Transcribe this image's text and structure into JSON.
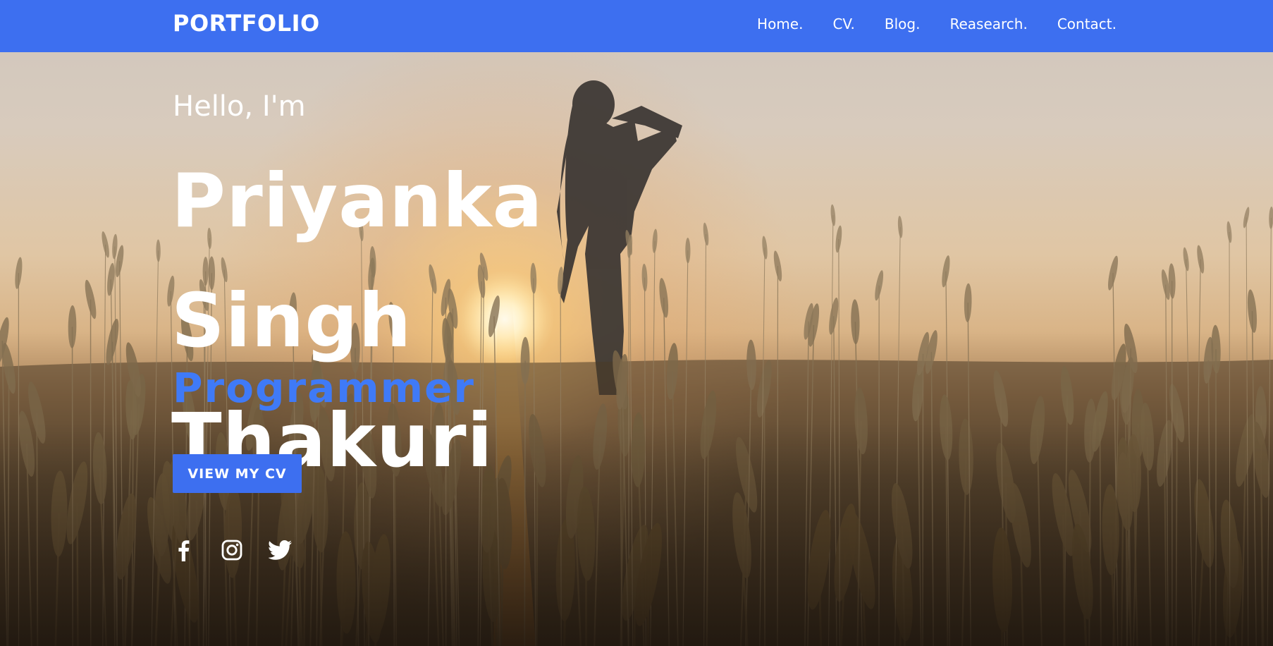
{
  "brand": "PORTFOLIO",
  "nav": {
    "items": [
      {
        "label": "Home."
      },
      {
        "label": "CV."
      },
      {
        "label": "Blog."
      },
      {
        "label": "Reasearch."
      },
      {
        "label": "Contact."
      }
    ]
  },
  "hero": {
    "greeting": "Hello, I'm",
    "name_line1": "Priyanka Singh",
    "name_line2": "Thakuri",
    "role": "Programmer",
    "cv_button": "VIEW MY CV"
  },
  "socials": [
    {
      "icon": "facebook-icon"
    },
    {
      "icon": "instagram-icon"
    },
    {
      "icon": "twitter-icon"
    }
  ],
  "colors": {
    "accent": "#3d6ff0",
    "role_text": "#3f7af7",
    "text": "#ffffff"
  }
}
